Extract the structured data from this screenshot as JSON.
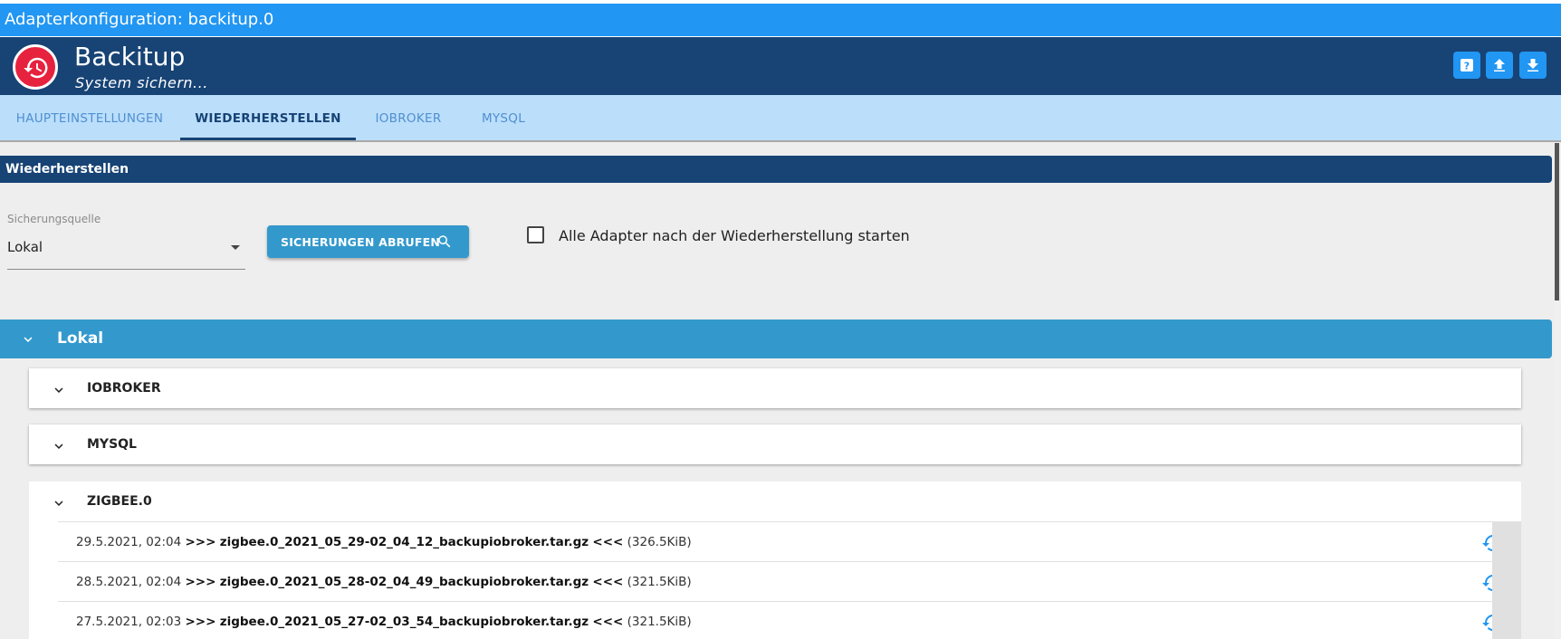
{
  "window": {
    "title": "Adapterkonfiguration: backitup.0"
  },
  "header": {
    "title": "Backitup",
    "subtitle": "System sichern...",
    "buttons": [
      "help-icon",
      "upload-icon",
      "download-icon"
    ]
  },
  "tabs": [
    {
      "label": "HAUPTEINSTELLUNGEN"
    },
    {
      "label": "WIEDERHERSTELLEN"
    },
    {
      "label": "IOBROKER"
    },
    {
      "label": "MYSQL"
    }
  ],
  "section": {
    "title": "Wiederherstellen"
  },
  "source": {
    "label": "Sicherungsquelle",
    "value": "Lokal"
  },
  "fetch_button": {
    "label": "SICHERUNGEN ABRUFEN"
  },
  "start_adapters": {
    "label": "Alle Adapter nach der Wiederherstellung starten",
    "checked": false
  },
  "groups": {
    "lokal": {
      "label": "Lokal"
    },
    "panels": [
      {
        "label": "IOBROKER"
      },
      {
        "label": "MYSQL"
      },
      {
        "label": "ZIGBEE.0"
      }
    ]
  },
  "backups": [
    {
      "date": "29.5.2021, 02:04",
      "prefix": ">>>",
      "file": "zigbee.0_2021_05_29-02_04_12_backupiobroker.tar.gz",
      "suffix": "<<<",
      "size": "(326.5KiB)"
    },
    {
      "date": "28.5.2021, 02:04",
      "prefix": ">>>",
      "file": "zigbee.0_2021_05_28-02_04_49_backupiobroker.tar.gz",
      "suffix": "<<<",
      "size": "(321.5KiB)"
    },
    {
      "date": "27.5.2021, 02:03",
      "prefix": ">>>",
      "file": "zigbee.0_2021_05_27-02_03_54_backupiobroker.tar.gz",
      "suffix": "<<<",
      "size": "(321.5KiB)"
    }
  ],
  "colors": {
    "titlebar": "#2196f3",
    "header": "#174375",
    "tabs_bg": "#bbdefb",
    "accent": "#3399cc",
    "logo": "#e6223e"
  }
}
